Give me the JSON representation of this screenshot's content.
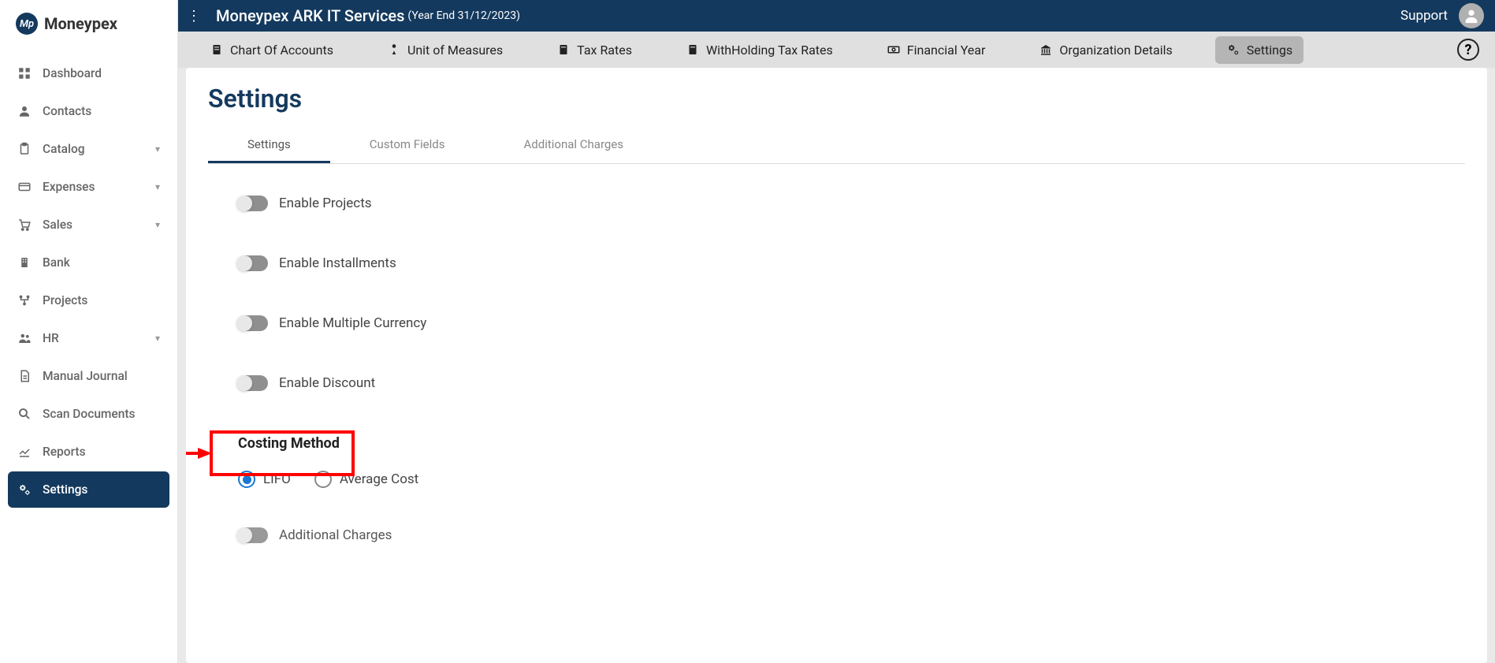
{
  "brand": {
    "name": "Moneypex",
    "badge": "Mp"
  },
  "header": {
    "title": "Moneypex ARK IT Services",
    "subtitle": "(Year End 31/12/2023)",
    "support": "Support"
  },
  "sidebar": {
    "items": [
      {
        "label": "Dashboard",
        "icon": "dashboard"
      },
      {
        "label": "Contacts",
        "icon": "user"
      },
      {
        "label": "Catalog",
        "icon": "clipboard",
        "expandable": true
      },
      {
        "label": "Expenses",
        "icon": "card",
        "expandable": true
      },
      {
        "label": "Sales",
        "icon": "cart",
        "expandable": true
      },
      {
        "label": "Bank",
        "icon": "building"
      },
      {
        "label": "Projects",
        "icon": "branch"
      },
      {
        "label": "HR",
        "icon": "people",
        "expandable": true
      },
      {
        "label": "Manual Journal",
        "icon": "doc"
      },
      {
        "label": "Scan Documents",
        "icon": "search"
      },
      {
        "label": "Reports",
        "icon": "chart"
      },
      {
        "label": "Settings",
        "icon": "gears",
        "active": true
      }
    ]
  },
  "subnav": {
    "items": [
      {
        "label": "Chart Of Accounts",
        "icon": "doc"
      },
      {
        "label": "Unit of Measures",
        "icon": "ruler"
      },
      {
        "label": "Tax Rates",
        "icon": "doc"
      },
      {
        "label": "WithHolding Tax Rates",
        "icon": "doc"
      },
      {
        "label": "Financial Year",
        "icon": "money"
      },
      {
        "label": "Organization Details",
        "icon": "org"
      },
      {
        "label": "Settings",
        "icon": "gears",
        "active": true
      }
    ]
  },
  "page": {
    "title": "Settings"
  },
  "tabs": [
    {
      "label": "Settings",
      "active": true
    },
    {
      "label": "Custom Fields"
    },
    {
      "label": "Additional Charges"
    }
  ],
  "toggles": [
    {
      "label": "Enable Projects"
    },
    {
      "label": "Enable Installments"
    },
    {
      "label": "Enable Multiple Currency"
    },
    {
      "label": "Enable Discount",
      "highlighted": true
    },
    {
      "label": "Additional Charges"
    }
  ],
  "costing": {
    "title": "Costing Method",
    "options": [
      {
        "label": "LIFO",
        "selected": true
      },
      {
        "label": "Average Cost"
      }
    ]
  }
}
